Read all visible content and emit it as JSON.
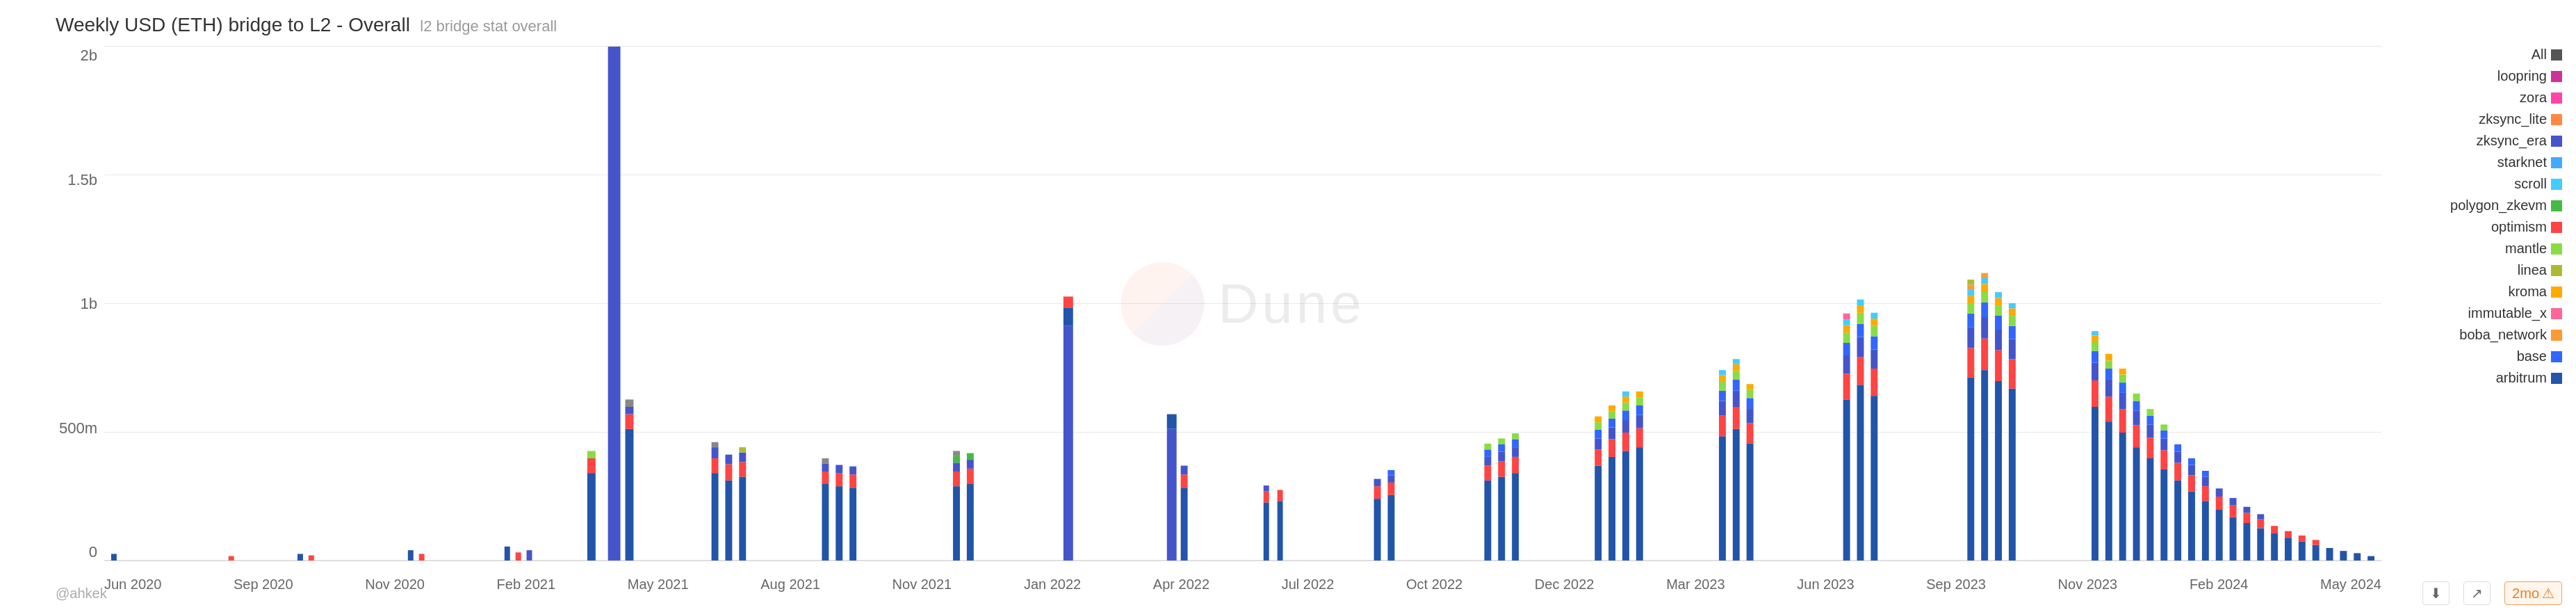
{
  "title": {
    "main": "Weekly USD (ETH) bridge to L2 - Overall",
    "sub": "l2 bridge stat overall"
  },
  "yAxis": {
    "labels": [
      "0",
      "500m",
      "1b",
      "1.5b",
      "2b"
    ]
  },
  "xAxis": {
    "labels": [
      "Jun 2020",
      "Sep 2020",
      "Nov 2020",
      "Feb 2021",
      "May 2021",
      "Aug 2021",
      "Nov 2021",
      "Jan 2022",
      "Apr 2022",
      "Jul 2022",
      "Oct 2022",
      "Dec 2022",
      "Mar 2023",
      "Jun 2023",
      "Sep 2023",
      "Nov 2023",
      "Feb 2024",
      "May 2024"
    ]
  },
  "legend": {
    "items": [
      {
        "label": "All",
        "color": "#555555"
      },
      {
        "label": "loopring",
        "color": "#cc3399"
      },
      {
        "label": "zora",
        "color": "#ff44aa"
      },
      {
        "label": "zksync_lite",
        "color": "#ff8844"
      },
      {
        "label": "zksync_era",
        "color": "#4455cc"
      },
      {
        "label": "starknet",
        "color": "#44aaff"
      },
      {
        "label": "scroll",
        "color": "#44ccff"
      },
      {
        "label": "polygon_zkevm",
        "color": "#44bb44"
      },
      {
        "label": "optimism",
        "color": "#ff4444"
      },
      {
        "label": "mantle",
        "color": "#88dd44"
      },
      {
        "label": "linea",
        "color": "#aabb33"
      },
      {
        "label": "kroma",
        "color": "#ffaa00"
      },
      {
        "label": "immutable_x",
        "color": "#ff6699"
      },
      {
        "label": "boba_network",
        "color": "#ff9933"
      },
      {
        "label": "base",
        "color": "#3366ff"
      },
      {
        "label": "arbitrum",
        "color": "#2255aa"
      }
    ]
  },
  "watermark": {
    "text": "Dune"
  },
  "attribution": "@ahkek",
  "controls": {
    "time_label": "2mo",
    "warning": "⚠"
  }
}
